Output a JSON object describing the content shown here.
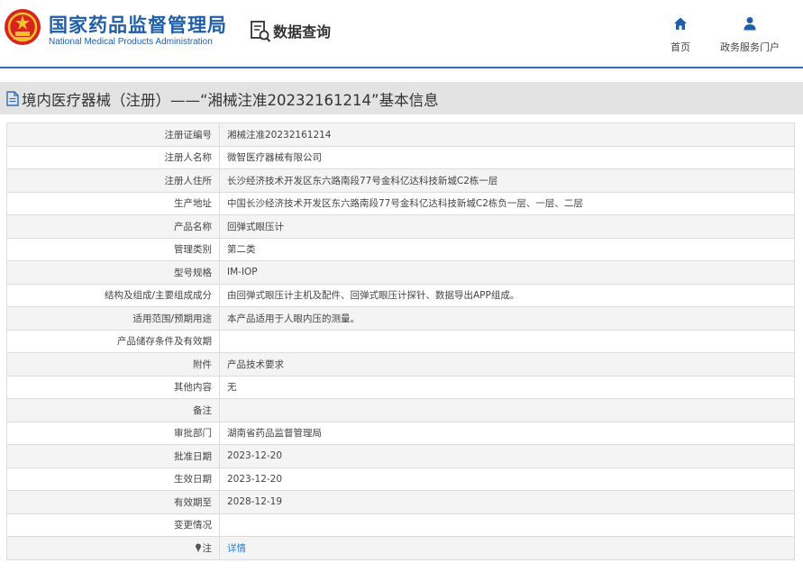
{
  "header": {
    "agency_cn": "国家药品监督管理局",
    "agency_en": "National Medical Products Administration",
    "query_label": "数据查询",
    "nav": [
      {
        "label": "首页",
        "icon": "home-icon"
      },
      {
        "label": "政务服务门户",
        "icon": "user-icon"
      }
    ]
  },
  "page": {
    "title": "境内医疗器械（注册）——“湘械注准20232161214”基本信息"
  },
  "colors": {
    "brand_blue": "#1f5fa9",
    "link_blue": "#2f7fd6",
    "logo_red": "#d9231d",
    "logo_gold": "#f2c12e"
  },
  "record": {
    "rows": [
      {
        "key": "注册证编号",
        "value": "湘械注准20232161214"
      },
      {
        "key": "注册人名称",
        "value": "微智医疗器械有限公司"
      },
      {
        "key": "注册人住所",
        "value": "长沙经济技术开发区东六路南段77号金科亿达科技新城C2栋一层"
      },
      {
        "key": "生产地址",
        "value": "中国长沙经济技术开发区东六路南段77号金科亿达科技新城C2栋负一层、一层、二层"
      },
      {
        "key": "产品名称",
        "value": "回弹式眼压计"
      },
      {
        "key": "管理类别",
        "value": "第二类"
      },
      {
        "key": "型号规格",
        "value": "IM-IOP"
      },
      {
        "key": "结构及组成/主要组成成分",
        "value": "由回弹式眼压计主机及配件、回弹式眼压计探针、数据导出APP组成。"
      },
      {
        "key": "适用范围/预期用途",
        "value": "本产品适用于人眼内压的测量。"
      },
      {
        "key": "产品储存条件及有效期",
        "value": ""
      },
      {
        "key": "附件",
        "value": "产品技术要求"
      },
      {
        "key": "其他内容",
        "value": "无"
      },
      {
        "key": "备注",
        "value": ""
      },
      {
        "key": "审批部门",
        "value": "湖南省药品监督管理局"
      },
      {
        "key": "批准日期",
        "value": "2023-12-20"
      },
      {
        "key": "生效日期",
        "value": "2023-12-20"
      },
      {
        "key": "有效期至",
        "value": "2028-12-19"
      },
      {
        "key": "变更情况",
        "value": ""
      }
    ],
    "note": {
      "key": "注",
      "icon": "pin-icon",
      "link_label": "详情"
    }
  }
}
